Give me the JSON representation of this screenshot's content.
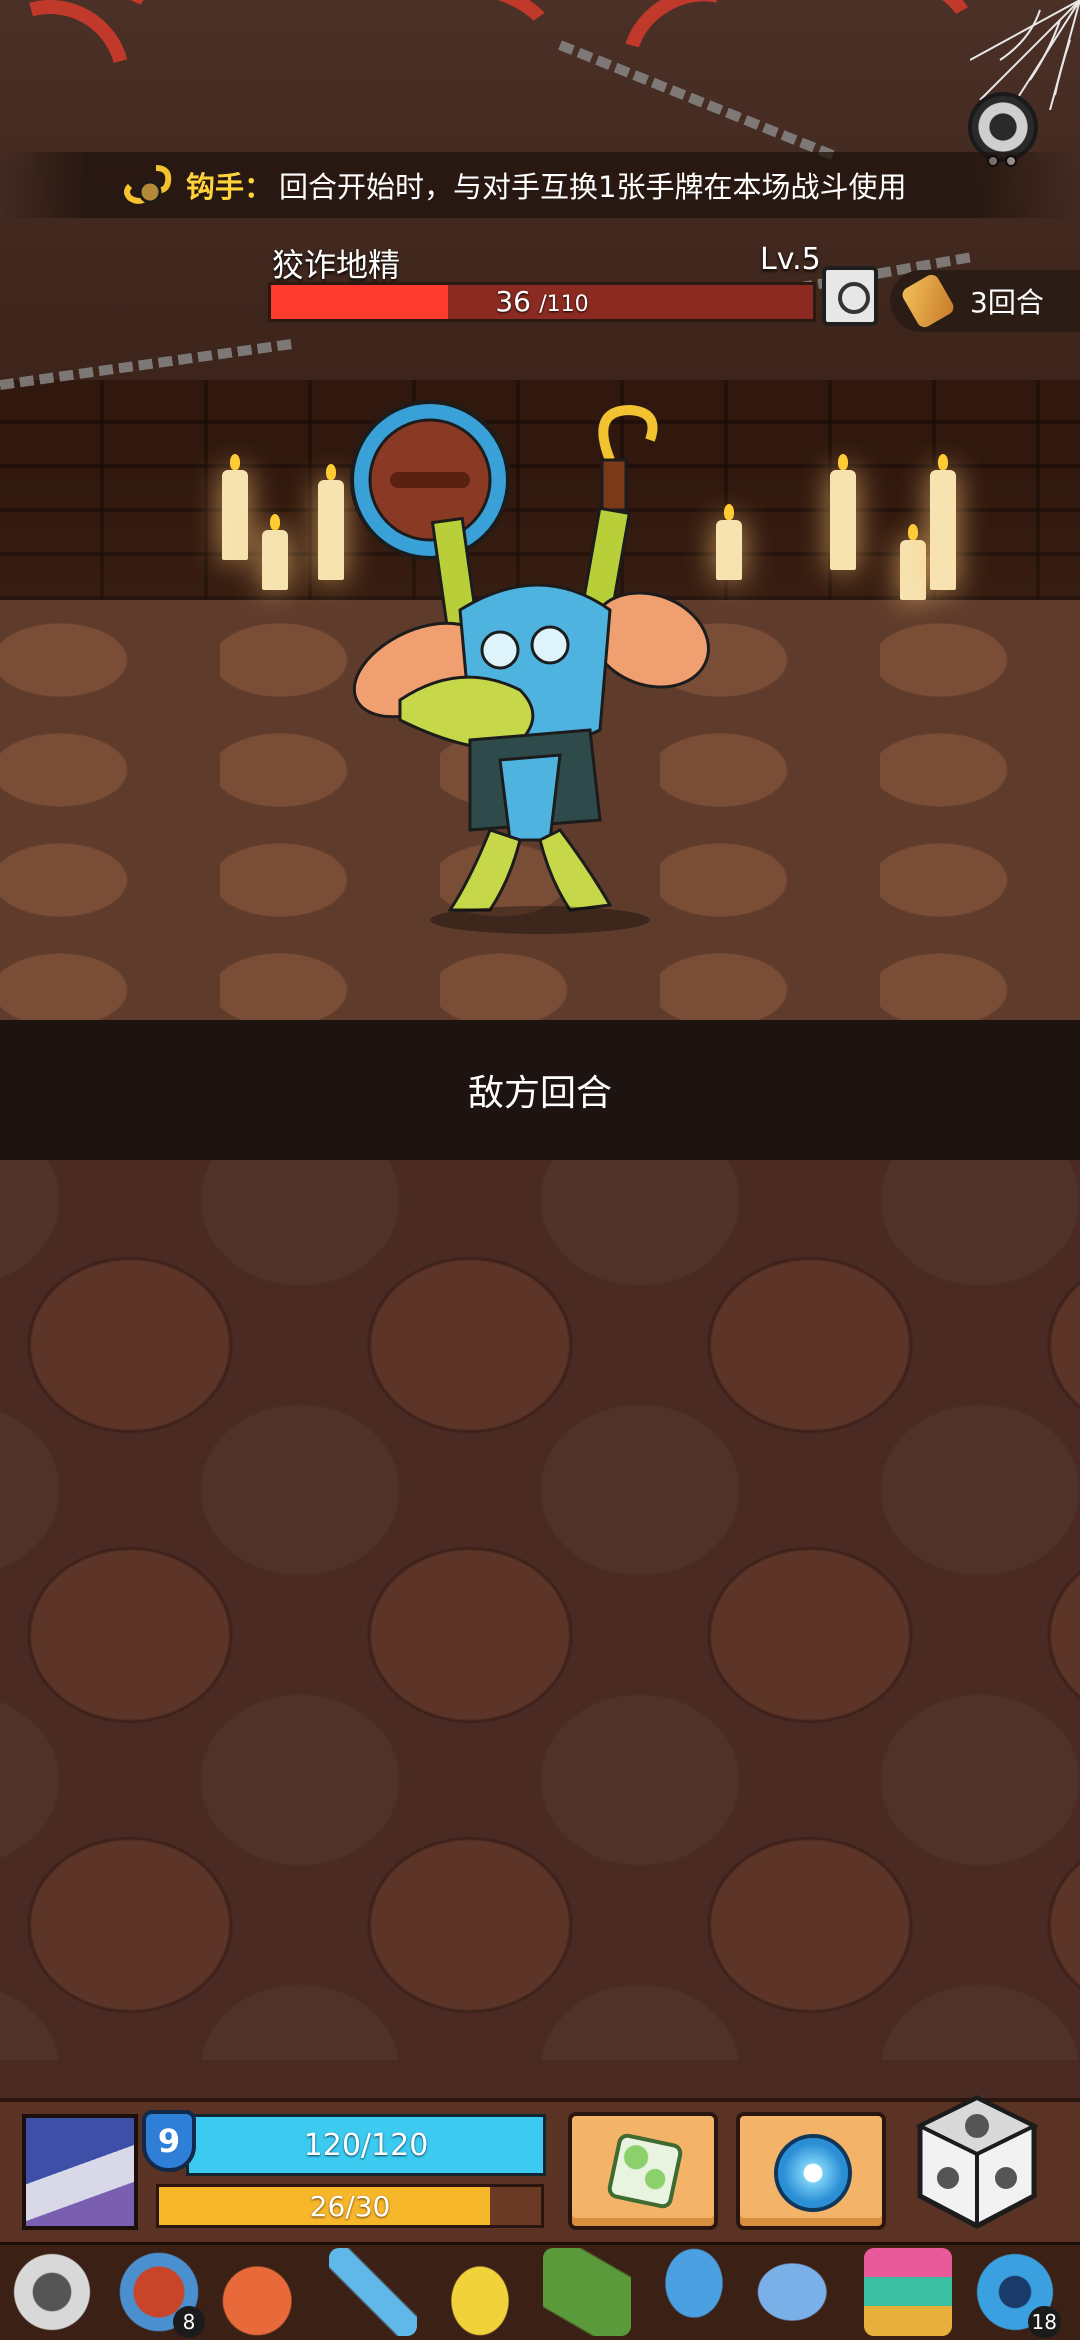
{
  "ability": {
    "name": "钩手：",
    "description": "回合开始时，与对手互换1张手牌在本场战斗使用",
    "icon": "hook-icon"
  },
  "enemy": {
    "name": "狡诈地精",
    "level": "Lv.5",
    "hp_current": "36",
    "hp_max": "/110",
    "hp_fraction": 0.327
  },
  "round": {
    "label": "3回合",
    "icon": "scroll-icon"
  },
  "turn_banner": "敌方回合",
  "player": {
    "shield": "9",
    "hp": "120/120",
    "hp_fraction": 1.0,
    "energy": "26/30",
    "energy_fraction": 0.867
  },
  "actions": [
    {
      "icon": "green-cube-icon"
    },
    {
      "icon": "blue-swirl-arrow-icon"
    }
  ],
  "dice": {
    "icon": "dice-icon"
  },
  "inventory": [
    {
      "icon": "silver-ring-icon",
      "count": ""
    },
    {
      "icon": "red-plate-icon",
      "count": "8"
    },
    {
      "icon": "meat-icon",
      "count": ""
    },
    {
      "icon": "ice-blade-icon",
      "count": ""
    },
    {
      "icon": "golden-crown-icon",
      "count": ""
    },
    {
      "icon": "green-slab-icon",
      "count": ""
    },
    {
      "icon": "blue-mushroom-icon",
      "count": ""
    },
    {
      "icon": "blue-horn-icon",
      "count": ""
    },
    {
      "icon": "totem-icon",
      "count": ""
    },
    {
      "icon": "blue-gem-icon",
      "count": "18"
    }
  ],
  "colors": {
    "enemy_hp": "#ff3b30",
    "player_hp": "#3ccaf0",
    "energy": "#f6b72a",
    "ability_name": "#ffd43b"
  }
}
